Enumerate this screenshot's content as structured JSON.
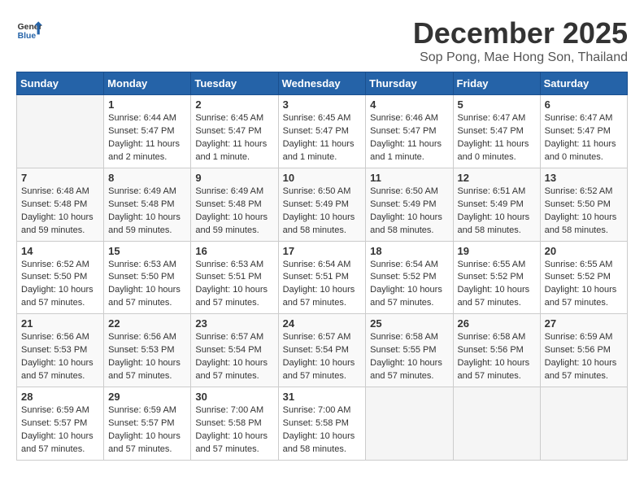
{
  "header": {
    "logo_line1": "General",
    "logo_line2": "Blue",
    "month_title": "December 2025",
    "location": "Sop Pong, Mae Hong Son, Thailand"
  },
  "weekdays": [
    "Sunday",
    "Monday",
    "Tuesday",
    "Wednesday",
    "Thursday",
    "Friday",
    "Saturday"
  ],
  "weeks": [
    [
      {
        "day": "",
        "sunrise": "",
        "sunset": "",
        "daylight": ""
      },
      {
        "day": "1",
        "sunrise": "Sunrise: 6:44 AM",
        "sunset": "Sunset: 5:47 PM",
        "daylight": "Daylight: 11 hours and 2 minutes."
      },
      {
        "day": "2",
        "sunrise": "Sunrise: 6:45 AM",
        "sunset": "Sunset: 5:47 PM",
        "daylight": "Daylight: 11 hours and 1 minute."
      },
      {
        "day": "3",
        "sunrise": "Sunrise: 6:45 AM",
        "sunset": "Sunset: 5:47 PM",
        "daylight": "Daylight: 11 hours and 1 minute."
      },
      {
        "day": "4",
        "sunrise": "Sunrise: 6:46 AM",
        "sunset": "Sunset: 5:47 PM",
        "daylight": "Daylight: 11 hours and 1 minute."
      },
      {
        "day": "5",
        "sunrise": "Sunrise: 6:47 AM",
        "sunset": "Sunset: 5:47 PM",
        "daylight": "Daylight: 11 hours and 0 minutes."
      },
      {
        "day": "6",
        "sunrise": "Sunrise: 6:47 AM",
        "sunset": "Sunset: 5:47 PM",
        "daylight": "Daylight: 11 hours and 0 minutes."
      }
    ],
    [
      {
        "day": "7",
        "sunrise": "Sunrise: 6:48 AM",
        "sunset": "Sunset: 5:48 PM",
        "daylight": "Daylight: 10 hours and 59 minutes."
      },
      {
        "day": "8",
        "sunrise": "Sunrise: 6:49 AM",
        "sunset": "Sunset: 5:48 PM",
        "daylight": "Daylight: 10 hours and 59 minutes."
      },
      {
        "day": "9",
        "sunrise": "Sunrise: 6:49 AM",
        "sunset": "Sunset: 5:48 PM",
        "daylight": "Daylight: 10 hours and 59 minutes."
      },
      {
        "day": "10",
        "sunrise": "Sunrise: 6:50 AM",
        "sunset": "Sunset: 5:49 PM",
        "daylight": "Daylight: 10 hours and 58 minutes."
      },
      {
        "day": "11",
        "sunrise": "Sunrise: 6:50 AM",
        "sunset": "Sunset: 5:49 PM",
        "daylight": "Daylight: 10 hours and 58 minutes."
      },
      {
        "day": "12",
        "sunrise": "Sunrise: 6:51 AM",
        "sunset": "Sunset: 5:49 PM",
        "daylight": "Daylight: 10 hours and 58 minutes."
      },
      {
        "day": "13",
        "sunrise": "Sunrise: 6:52 AM",
        "sunset": "Sunset: 5:50 PM",
        "daylight": "Daylight: 10 hours and 58 minutes."
      }
    ],
    [
      {
        "day": "14",
        "sunrise": "Sunrise: 6:52 AM",
        "sunset": "Sunset: 5:50 PM",
        "daylight": "Daylight: 10 hours and 57 minutes."
      },
      {
        "day": "15",
        "sunrise": "Sunrise: 6:53 AM",
        "sunset": "Sunset: 5:50 PM",
        "daylight": "Daylight: 10 hours and 57 minutes."
      },
      {
        "day": "16",
        "sunrise": "Sunrise: 6:53 AM",
        "sunset": "Sunset: 5:51 PM",
        "daylight": "Daylight: 10 hours and 57 minutes."
      },
      {
        "day": "17",
        "sunrise": "Sunrise: 6:54 AM",
        "sunset": "Sunset: 5:51 PM",
        "daylight": "Daylight: 10 hours and 57 minutes."
      },
      {
        "day": "18",
        "sunrise": "Sunrise: 6:54 AM",
        "sunset": "Sunset: 5:52 PM",
        "daylight": "Daylight: 10 hours and 57 minutes."
      },
      {
        "day": "19",
        "sunrise": "Sunrise: 6:55 AM",
        "sunset": "Sunset: 5:52 PM",
        "daylight": "Daylight: 10 hours and 57 minutes."
      },
      {
        "day": "20",
        "sunrise": "Sunrise: 6:55 AM",
        "sunset": "Sunset: 5:52 PM",
        "daylight": "Daylight: 10 hours and 57 minutes."
      }
    ],
    [
      {
        "day": "21",
        "sunrise": "Sunrise: 6:56 AM",
        "sunset": "Sunset: 5:53 PM",
        "daylight": "Daylight: 10 hours and 57 minutes."
      },
      {
        "day": "22",
        "sunrise": "Sunrise: 6:56 AM",
        "sunset": "Sunset: 5:53 PM",
        "daylight": "Daylight: 10 hours and 57 minutes."
      },
      {
        "day": "23",
        "sunrise": "Sunrise: 6:57 AM",
        "sunset": "Sunset: 5:54 PM",
        "daylight": "Daylight: 10 hours and 57 minutes."
      },
      {
        "day": "24",
        "sunrise": "Sunrise: 6:57 AM",
        "sunset": "Sunset: 5:54 PM",
        "daylight": "Daylight: 10 hours and 57 minutes."
      },
      {
        "day": "25",
        "sunrise": "Sunrise: 6:58 AM",
        "sunset": "Sunset: 5:55 PM",
        "daylight": "Daylight: 10 hours and 57 minutes."
      },
      {
        "day": "26",
        "sunrise": "Sunrise: 6:58 AM",
        "sunset": "Sunset: 5:56 PM",
        "daylight": "Daylight: 10 hours and 57 minutes."
      },
      {
        "day": "27",
        "sunrise": "Sunrise: 6:59 AM",
        "sunset": "Sunset: 5:56 PM",
        "daylight": "Daylight: 10 hours and 57 minutes."
      }
    ],
    [
      {
        "day": "28",
        "sunrise": "Sunrise: 6:59 AM",
        "sunset": "Sunset: 5:57 PM",
        "daylight": "Daylight: 10 hours and 57 minutes."
      },
      {
        "day": "29",
        "sunrise": "Sunrise: 6:59 AM",
        "sunset": "Sunset: 5:57 PM",
        "daylight": "Daylight: 10 hours and 57 minutes."
      },
      {
        "day": "30",
        "sunrise": "Sunrise: 7:00 AM",
        "sunset": "Sunset: 5:58 PM",
        "daylight": "Daylight: 10 hours and 57 minutes."
      },
      {
        "day": "31",
        "sunrise": "Sunrise: 7:00 AM",
        "sunset": "Sunset: 5:58 PM",
        "daylight": "Daylight: 10 hours and 58 minutes."
      },
      {
        "day": "",
        "sunrise": "",
        "sunset": "",
        "daylight": ""
      },
      {
        "day": "",
        "sunrise": "",
        "sunset": "",
        "daylight": ""
      },
      {
        "day": "",
        "sunrise": "",
        "sunset": "",
        "daylight": ""
      }
    ]
  ]
}
